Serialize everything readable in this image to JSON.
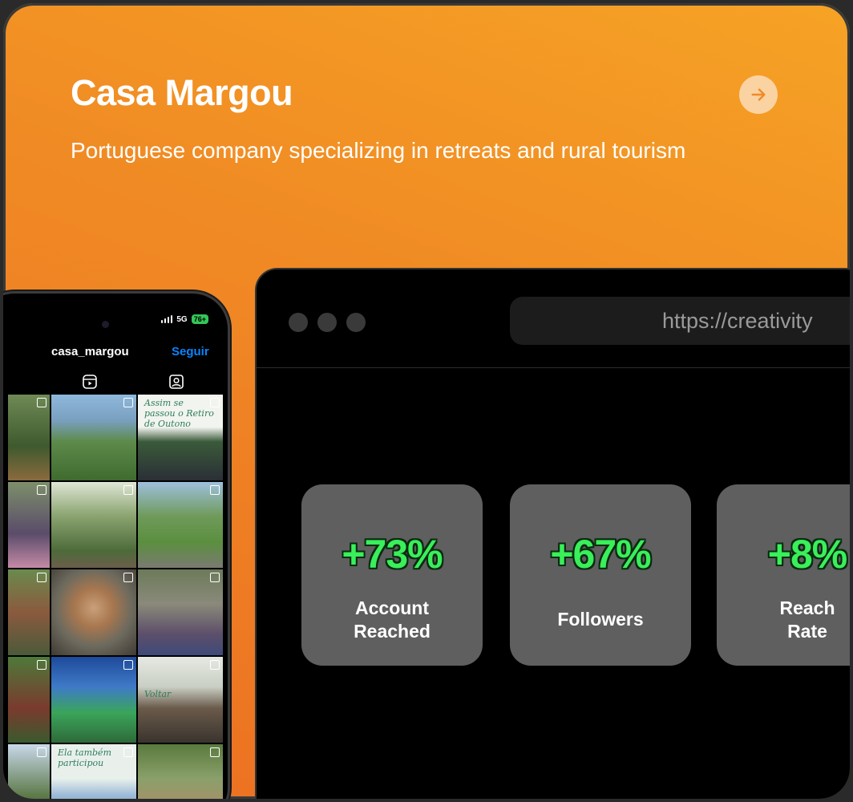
{
  "header": {
    "title": "Casa Margou",
    "subtitle": "Portuguese company specializing in retreats and rural tourism"
  },
  "phone": {
    "status_network": "5G",
    "status_battery": "76+",
    "username": "casa_margou",
    "follow_label": "Seguir",
    "posts": [
      {
        "caption": ""
      },
      {
        "caption": ""
      },
      {
        "caption": "Assim se passou o Retiro de Outono"
      },
      {
        "caption": ""
      },
      {
        "caption": ""
      },
      {
        "caption": ""
      },
      {
        "caption": ""
      },
      {
        "caption": ""
      },
      {
        "caption": ""
      },
      {
        "caption": ""
      },
      {
        "caption": ""
      },
      {
        "caption": "Voltar"
      },
      {
        "caption": ""
      },
      {
        "caption": "Ela também participou"
      },
      {
        "caption": ""
      }
    ]
  },
  "browser": {
    "url": "https://creativity"
  },
  "stats": [
    {
      "value": "+73%",
      "label": "Account Reached"
    },
    {
      "value": "+67%",
      "label": "Followers"
    },
    {
      "value": "+8%",
      "label": "Reach Rate"
    }
  ],
  "colors": {
    "accent_orange": "#f08a24",
    "stat_green": "#39ef5a",
    "follow_blue": "#0a84ff"
  }
}
